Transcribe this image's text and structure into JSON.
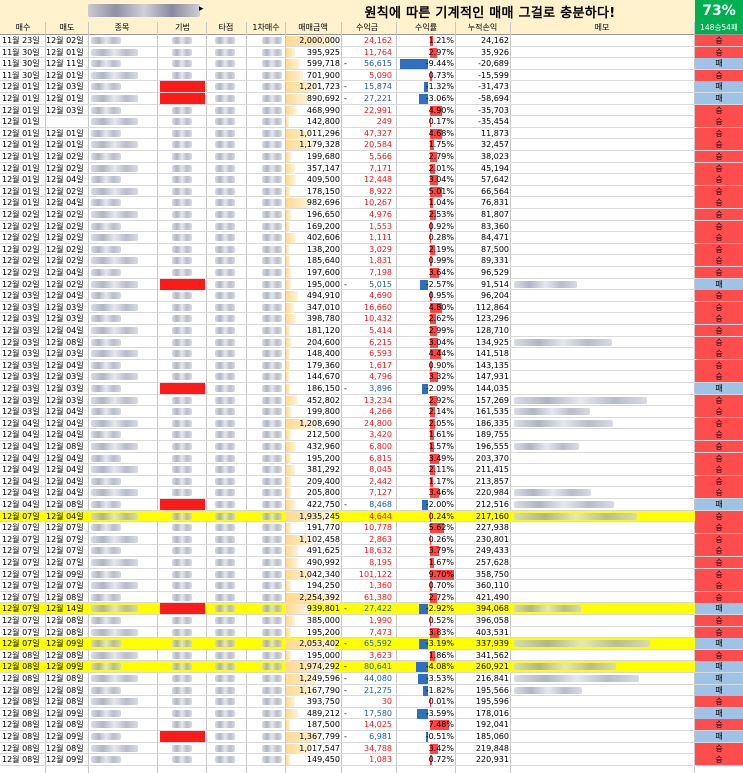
{
  "title": "원칙에 따른 기계적인 매매 그걸로 충분하다!",
  "win_pct": "73%",
  "record": "148승54패",
  "headers": {
    "buy_date": "매수",
    "sell_date": "매도",
    "name": "종목",
    "category": "기법",
    "timing": "타점",
    "first_buy": "1차매수",
    "amount": "매매금액",
    "profit": "수익금",
    "rate": "수익률",
    "cumulative": "누적손익",
    "memo": "메모"
  },
  "colors": {
    "win": "#ff4d4d",
    "loss": "#9dc3e6",
    "positive": "#e61919",
    "negative": "#1f5fb3",
    "highlight": "#ffff00"
  },
  "rows": [
    {
      "b": "11월 23일",
      "s": "12월 02일",
      "amt": "2,000,000",
      "p": "24,162",
      "r": "1.21%",
      "c": "24,162",
      "res": "승"
    },
    {
      "b": "11월 30일",
      "s": "12월 01일",
      "amt": "395,925",
      "p": "11,764",
      "r": "2.97%",
      "c": "35,926",
      "res": "승"
    },
    {
      "b": "11월 30일",
      "s": "12월 11일",
      "amt": "599,718",
      "p": "56,615",
      "r": "-9.44%",
      "c": "-20,689",
      "res": "패",
      "neg": true
    },
    {
      "b": "11월 30일",
      "s": "12월 01일",
      "amt": "701,900",
      "p": "5,090",
      "r": "0.73%",
      "c": "-15,599",
      "res": "승"
    },
    {
      "b": "12월 01일",
      "s": "12월 03일",
      "amt": "1,201,723",
      "p": "15,874",
      "r": "-1.32%",
      "c": "-31,473",
      "res": "패",
      "neg": true,
      "red": true
    },
    {
      "b": "12월 01일",
      "s": "12월 01일",
      "amt": "890,692",
      "p": "27,221",
      "r": "-3.06%",
      "c": "-58,694",
      "res": "패",
      "neg": true,
      "red": true
    },
    {
      "b": "12월 01일",
      "s": "12월 03일",
      "amt": "468,990",
      "p": "22,991",
      "r": "4.90%",
      "c": "-35,703",
      "res": "승"
    },
    {
      "b": "12월 01일",
      "s": "",
      "amt": "142,800",
      "p": "249",
      "r": "0.17%",
      "c": "-35,454",
      "res": "승"
    },
    {
      "b": "12월 01일",
      "s": "12월 01일",
      "amt": "1,011,296",
      "p": "47,327",
      "r": "4.68%",
      "c": "11,873",
      "res": "승"
    },
    {
      "b": "12월 01일",
      "s": "12월 01일",
      "amt": "1,179,328",
      "p": "20,584",
      "r": "1.75%",
      "c": "32,457",
      "res": "승"
    },
    {
      "b": "12월 01일",
      "s": "12월 02일",
      "amt": "199,680",
      "p": "5,566",
      "r": "2.79%",
      "c": "38,023",
      "res": "승"
    },
    {
      "b": "12월 01일",
      "s": "12월 02일",
      "amt": "357,147",
      "p": "7,171",
      "r": "2.01%",
      "c": "45,194",
      "res": "승"
    },
    {
      "b": "12월 01일",
      "s": "12월 04일",
      "amt": "409,500",
      "p": "12,448",
      "r": "3.04%",
      "c": "57,642",
      "res": "승"
    },
    {
      "b": "12월 01일",
      "s": "12월 02일",
      "amt": "178,150",
      "p": "8,922",
      "r": "5.01%",
      "c": "66,564",
      "res": "승"
    },
    {
      "b": "12월 01일",
      "s": "12월 04일",
      "amt": "982,696",
      "p": "10,267",
      "r": "1.04%",
      "c": "76,831",
      "res": "승"
    },
    {
      "b": "12월 02일",
      "s": "12월 02일",
      "amt": "196,650",
      "p": "4,976",
      "r": "2.53%",
      "c": "81,807",
      "res": "승"
    },
    {
      "b": "12월 02일",
      "s": "12월 02일",
      "amt": "169,200",
      "p": "1,553",
      "r": "0.92%",
      "c": "83,360",
      "res": "승"
    },
    {
      "b": "12월 02일",
      "s": "12월 02일",
      "amt": "402,606",
      "p": "1,111",
      "r": "0.28%",
      "c": "84,471",
      "res": "승"
    },
    {
      "b": "12월 02일",
      "s": "12월 02일",
      "amt": "138,200",
      "p": "3,029",
      "r": "2.19%",
      "c": "87,500",
      "res": "승"
    },
    {
      "b": "12월 02일",
      "s": "12월 02일",
      "amt": "185,640",
      "p": "1,831",
      "r": "0.99%",
      "c": "89,331",
      "res": "승"
    },
    {
      "b": "12월 02일",
      "s": "12월 04일",
      "amt": "197,600",
      "p": "7,198",
      "r": "3.64%",
      "c": "96,529",
      "res": "승"
    },
    {
      "b": "12월 02일",
      "s": "12월 02일",
      "amt": "195,000",
      "p": "5,015",
      "r": "-2.57%",
      "c": "91,514",
      "res": "패",
      "neg": true,
      "red": true,
      "memo": true
    },
    {
      "b": "12월 03일",
      "s": "12월 04일",
      "amt": "494,910",
      "p": "4,690",
      "r": "0.95%",
      "c": "96,204",
      "res": "승"
    },
    {
      "b": "12월 03일",
      "s": "12월 03일",
      "amt": "347,010",
      "p": "16,660",
      "r": "4.80%",
      "c": "112,864",
      "res": "승"
    },
    {
      "b": "12월 03일",
      "s": "12월 03일",
      "amt": "398,780",
      "p": "10,432",
      "r": "2.62%",
      "c": "123,296",
      "res": "승"
    },
    {
      "b": "12월 03일",
      "s": "12월 04일",
      "amt": "181,120",
      "p": "5,414",
      "r": "2.99%",
      "c": "128,710",
      "res": "승"
    },
    {
      "b": "12월 03일",
      "s": "12월 08일",
      "amt": "204,600",
      "p": "6,215",
      "r": "3.04%",
      "c": "134,925",
      "res": "승",
      "memo": true
    },
    {
      "b": "12월 03일",
      "s": "12월 03일",
      "amt": "148,400",
      "p": "6,593",
      "r": "4.44%",
      "c": "141,518",
      "res": "승"
    },
    {
      "b": "12월 03일",
      "s": "12월 04일",
      "amt": "179,360",
      "p": "1,617",
      "r": "0.90%",
      "c": "143,135",
      "res": "승"
    },
    {
      "b": "12월 03일",
      "s": "12월 03일",
      "amt": "144,670",
      "p": "4,796",
      "r": "3.32%",
      "c": "147,931",
      "res": "승"
    },
    {
      "b": "12월 03일",
      "s": "12월 03일",
      "amt": "186,150",
      "p": "3,896",
      "r": "-2.09%",
      "c": "144,035",
      "res": "패",
      "neg": true,
      "red": true
    },
    {
      "b": "12월 03일",
      "s": "12월 03일",
      "amt": "452,802",
      "p": "13,234",
      "r": "2.92%",
      "c": "157,269",
      "res": "승",
      "memo": true
    },
    {
      "b": "12월 03일",
      "s": "12월 04일",
      "amt": "199,800",
      "p": "4,266",
      "r": "2.14%",
      "c": "161,535",
      "res": "승",
      "memo": true
    },
    {
      "b": "12월 04일",
      "s": "12월 04일",
      "amt": "1,208,690",
      "p": "24,800",
      "r": "2.05%",
      "c": "186,335",
      "res": "승",
      "memo": true
    },
    {
      "b": "12월 04일",
      "s": "12월 04일",
      "amt": "212,500",
      "p": "3,420",
      "r": "1.61%",
      "c": "189,755",
      "res": "승"
    },
    {
      "b": "12월 04일",
      "s": "12월 08일",
      "amt": "432,960",
      "p": "6,800",
      "r": "1.57%",
      "c": "196,555",
      "res": "승",
      "memo": true
    },
    {
      "b": "12월 04일",
      "s": "12월 04일",
      "amt": "195,200",
      "p": "6,815",
      "r": "3.49%",
      "c": "203,370",
      "res": "승"
    },
    {
      "b": "12월 04일",
      "s": "12월 04일",
      "amt": "381,292",
      "p": "8,045",
      "r": "2.11%",
      "c": "211,415",
      "res": "승"
    },
    {
      "b": "12월 04일",
      "s": "12월 04일",
      "amt": "209,400",
      "p": "2,442",
      "r": "1.17%",
      "c": "213,857",
      "res": "승"
    },
    {
      "b": "12월 04일",
      "s": "12월 04일",
      "amt": "205,800",
      "p": "7,127",
      "r": "3.46%",
      "c": "220,984",
      "res": "승",
      "memo": true
    },
    {
      "b": "12월 04일",
      "s": "12월 08일",
      "amt": "422,750",
      "p": "8,468",
      "r": "-2.00%",
      "c": "212,516",
      "res": "패",
      "neg": true,
      "red": true,
      "memo": true
    },
    {
      "b": "12월 07일",
      "s": "12월 04일",
      "amt": "1,935,245",
      "p": "4,644",
      "r": "0.24%",
      "c": "217,160",
      "res": "승",
      "hl": true,
      "memo": true
    },
    {
      "b": "12월 07일",
      "s": "12월 07일",
      "amt": "191,770",
      "p": "10,778",
      "r": "5.62%",
      "c": "227,938",
      "res": "승"
    },
    {
      "b": "12월 07일",
      "s": "12월 07일",
      "amt": "1,102,458",
      "p": "2,863",
      "r": "0.26%",
      "c": "230,801",
      "res": "승"
    },
    {
      "b": "12월 07일",
      "s": "12월 07일",
      "amt": "491,625",
      "p": "18,632",
      "r": "3.79%",
      "c": "249,433",
      "res": "승"
    },
    {
      "b": "12월 07일",
      "s": "12월 07일",
      "amt": "490,992",
      "p": "8,195",
      "r": "1.67%",
      "c": "257,628",
      "res": "승"
    },
    {
      "b": "12월 07일",
      "s": "12월 09일",
      "amt": "1,042,340",
      "p": "101,122",
      "r": "9.70%",
      "c": "358,750",
      "res": "승"
    },
    {
      "b": "12월 07일",
      "s": "12월 07일",
      "amt": "194,250",
      "p": "1,360",
      "r": "0.70%",
      "c": "360,110",
      "res": "승"
    },
    {
      "b": "12월 07일",
      "s": "12월 08일",
      "amt": "2,254,392",
      "p": "61,380",
      "r": "2.72%",
      "c": "421,490",
      "res": "승"
    },
    {
      "b": "12월 07일",
      "s": "12월 14일",
      "amt": "939,801",
      "p": "27,422",
      "r": "-2.92%",
      "c": "394,068",
      "res": "패",
      "neg": true,
      "red": true,
      "hl": true,
      "memo": true
    },
    {
      "b": "12월 07일",
      "s": "12월 08일",
      "amt": "385,000",
      "p": "1,990",
      "r": "0.52%",
      "c": "396,058",
      "res": "승"
    },
    {
      "b": "12월 07일",
      "s": "12월 08일",
      "amt": "195,200",
      "p": "7,473",
      "r": "3.83%",
      "c": "403,531",
      "res": "승"
    },
    {
      "b": "12월 07일",
      "s": "12월 09일",
      "amt": "2,053,402",
      "p": "65,592",
      "r": "-3.19%",
      "c": "337,939",
      "res": "패",
      "neg": true,
      "hl": true,
      "memo": true
    },
    {
      "b": "12월 08일",
      "s": "12월 08일",
      "amt": "195,000",
      "p": "3,623",
      "r": "1.86%",
      "c": "341,562",
      "res": "승"
    },
    {
      "b": "12월 08일",
      "s": "12월 09일",
      "amt": "1,974,292",
      "p": "80,641",
      "r": "-4.08%",
      "c": "260,921",
      "res": "패",
      "neg": true,
      "hl": true,
      "memo": true
    },
    {
      "b": "12월 08일",
      "s": "12월 08일",
      "amt": "1,249,596",
      "p": "44,080",
      "r": "-3.53%",
      "c": "216,841",
      "res": "패",
      "neg": true,
      "memo": true
    },
    {
      "b": "12월 08일",
      "s": "12월 08일",
      "amt": "1,167,790",
      "p": "21,275",
      "r": "-1.82%",
      "c": "195,566",
      "res": "패",
      "neg": true,
      "memo": true
    },
    {
      "b": "12월 08일",
      "s": "12월 08일",
      "amt": "393,750",
      "p": "30",
      "r": "0.01%",
      "c": "195,596",
      "res": "승"
    },
    {
      "b": "12월 08일",
      "s": "12월 09일",
      "amt": "489,212",
      "p": "17,580",
      "r": "-3.59%",
      "c": "178,016",
      "res": "패",
      "neg": true
    },
    {
      "b": "12월 08일",
      "s": "12월 08일",
      "amt": "187,500",
      "p": "14,025",
      "r": "7.48%",
      "c": "192,041",
      "res": "승"
    },
    {
      "b": "12월 08일",
      "s": "12월 09일",
      "amt": "1,367,799",
      "p": "6,981",
      "r": "-0.51%",
      "c": "185,060",
      "res": "패",
      "neg": true,
      "red": true
    },
    {
      "b": "12월 08일",
      "s": "12월 08일",
      "amt": "1,017,547",
      "p": "34,788",
      "r": "3.42%",
      "c": "219,848",
      "res": "승"
    },
    {
      "b": "12월 08일",
      "s": "12월 09일",
      "amt": "149,450",
      "p": "1,083",
      "r": "0.72%",
      "c": "220,931",
      "res": "승"
    }
  ]
}
